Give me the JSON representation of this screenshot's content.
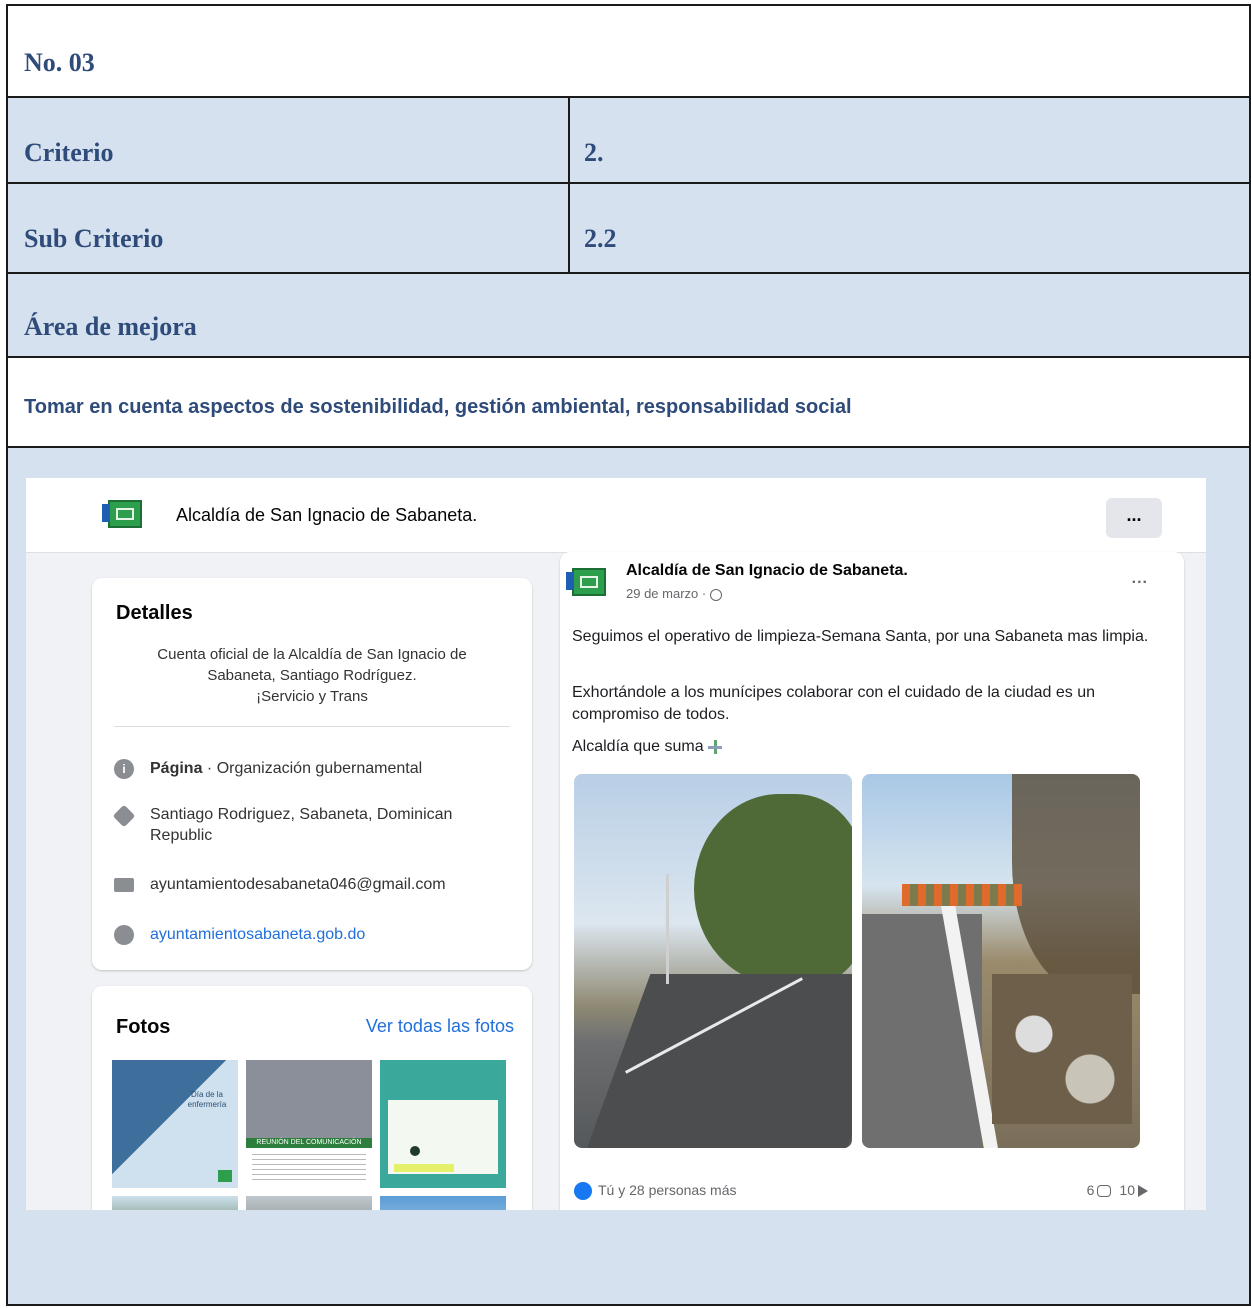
{
  "document": {
    "number": "No. 03",
    "criterio_label": "Criterio",
    "criterio_value": "2.",
    "subcriterio_label": "Sub Criterio",
    "subcriterio_value": "2.2",
    "area_label": "Área de mejora",
    "area_text": "Tomar en cuenta aspectos de sostenibilidad, gestión ambiental, responsabilidad social",
    "colors": {
      "border": "#1a1a1a",
      "heading": "#2e4b7a",
      "cell_bg": "#d6e1f0"
    }
  },
  "facebook": {
    "page_name": "Alcaldía de San Ignacio de Sabaneta.",
    "more_label": "...",
    "details": {
      "title": "Detalles",
      "bio_line1": "Cuenta oficial de la Alcaldía de San Ignacio de",
      "bio_line2": "Sabaneta, Santiago Rodríguez.",
      "bio_line3": "¡Servicio y Trans",
      "category_bold": "Página",
      "category_rest": " · Organización gubernamental",
      "location": "Santiago Rodriguez, Sabaneta, Dominican Republic",
      "email": "ayuntamientodesabaneta046@gmail.com",
      "website": "ayuntamientosabaneta.gob.do"
    },
    "fotos": {
      "title": "Fotos",
      "see_all": "Ver todas las fotos",
      "thumb1_text": "Día de la enfermería",
      "thumb2_text": "REUNIÓN DEL COMUNICACIÓN"
    },
    "post": {
      "author": "Alcaldía de San Ignacio de Sabaneta.",
      "date": "29 de marzo ·",
      "more": "...",
      "paragraph1": "Seguimos el operativo de limpieza-Semana Santa, por una Sabaneta mas limpia.",
      "paragraph2": "Exhortándole a los munícipes colaborar con el cuidado de la ciudad es un compromiso de todos.",
      "paragraph3": "Alcaldía que suma",
      "reactions": "Tú y 28 personas más",
      "comments_count": "6",
      "shares_count": "10"
    },
    "colors": {
      "link": "#216fdb",
      "like": "#1877f2",
      "brand_green": "#2d9f4c"
    }
  }
}
